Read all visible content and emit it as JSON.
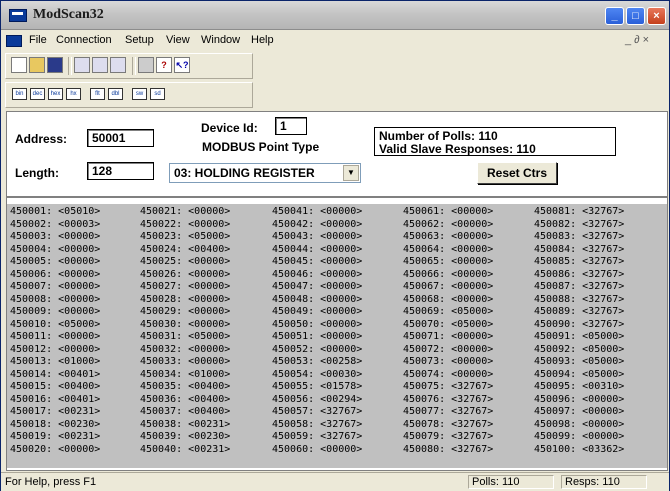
{
  "window": {
    "title": "ModScan32"
  },
  "menu": {
    "items": [
      "File",
      "Connection",
      "Setup",
      "View",
      "Window",
      "Help"
    ],
    "mdi_controls": "_ ∂ ×"
  },
  "form": {
    "address_label": "Address:",
    "address_value": "50001",
    "length_label": "Length:",
    "length_value": "128",
    "device_id_label": "Device Id:",
    "device_id_value": "1",
    "point_type_label": "MODBUS Point Type",
    "point_type_value": "03: HOLDING REGISTER",
    "polls_text": "Number of Polls: 110",
    "valid_text": "Valid Slave Responses: 110",
    "reset_label": "Reset Ctrs"
  },
  "registers": [
    [
      "450001: <05010>",
      "450002: <00003>",
      "450003: <00000>",
      "450004: <00000>",
      "450005: <00000>",
      "450006: <00000>",
      "450007: <00000>",
      "450008: <00000>",
      "450009: <00000>",
      "450010: <05000>",
      "450011: <00000>",
      "450012: <00000>",
      "450013: <01000>",
      "450014: <00401>",
      "450015: <00400>",
      "450016: <00401>",
      "450017: <00231>",
      "450018: <00230>",
      "450019: <00231>",
      "450020: <00000>"
    ],
    [
      "450021: <00000>",
      "450022: <00000>",
      "450023: <05000>",
      "450024: <00400>",
      "450025: <00000>",
      "450026: <00000>",
      "450027: <00000>",
      "450028: <00000>",
      "450029: <00000>",
      "450030: <00000>",
      "450031: <05000>",
      "450032: <00000>",
      "450033: <00000>",
      "450034: <01000>",
      "450035: <00400>",
      "450036: <00400>",
      "450037: <00400>",
      "450038: <00231>",
      "450039: <00230>",
      "450040: <00231>"
    ],
    [
      "450041: <00000>",
      "450042: <00000>",
      "450043: <00000>",
      "450044: <00000>",
      "450045: <00000>",
      "450046: <00000>",
      "450047: <00000>",
      "450048: <00000>",
      "450049: <00000>",
      "450050: <00000>",
      "450051: <00000>",
      "450052: <00000>",
      "450053: <00258>",
      "450054: <00030>",
      "450055: <01578>",
      "450056: <00294>",
      "450057: <32767>",
      "450058: <32767>",
      "450059: <32767>",
      "450060: <00000>"
    ],
    [
      "450061: <00000>",
      "450062: <00000>",
      "450063: <00000>",
      "450064: <00000>",
      "450065: <00000>",
      "450066: <00000>",
      "450067: <00000>",
      "450068: <00000>",
      "450069: <05000>",
      "450070: <05000>",
      "450071: <00000>",
      "450072: <00000>",
      "450073: <00000>",
      "450074: <00000>",
      "450075: <32767>",
      "450076: <32767>",
      "450077: <32767>",
      "450078: <32767>",
      "450079: <32767>",
      "450080: <32767>"
    ],
    [
      "450081: <32767>",
      "450082: <32767>",
      "450083: <32767>",
      "450084: <32767>",
      "450085: <32767>",
      "450086: <32767>",
      "450087: <32767>",
      "450088: <32767>",
      "450089: <32767>",
      "450090: <32767>",
      "450091: <05000>",
      "450092: <05000>",
      "450093: <05000>",
      "450094: <05000>",
      "450095: <00310>",
      "450096: <00000>",
      "450097: <00000>",
      "450098: <00000>",
      "450099: <00000>",
      "450100: <03362>"
    ]
  ],
  "status": {
    "help": "For Help, press F1",
    "polls": "Polls: 110",
    "resps": "Resps: 110"
  }
}
